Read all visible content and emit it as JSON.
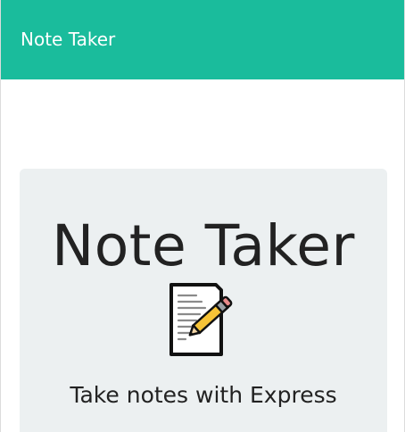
{
  "navbar": {
    "brand": "Note Taker",
    "background_color": "#1abc9c"
  },
  "jumbotron": {
    "title": "Note Taker",
    "icon": "memo-icon",
    "subtitle": "Take notes with Express",
    "background_color": "#ecf0f1"
  }
}
